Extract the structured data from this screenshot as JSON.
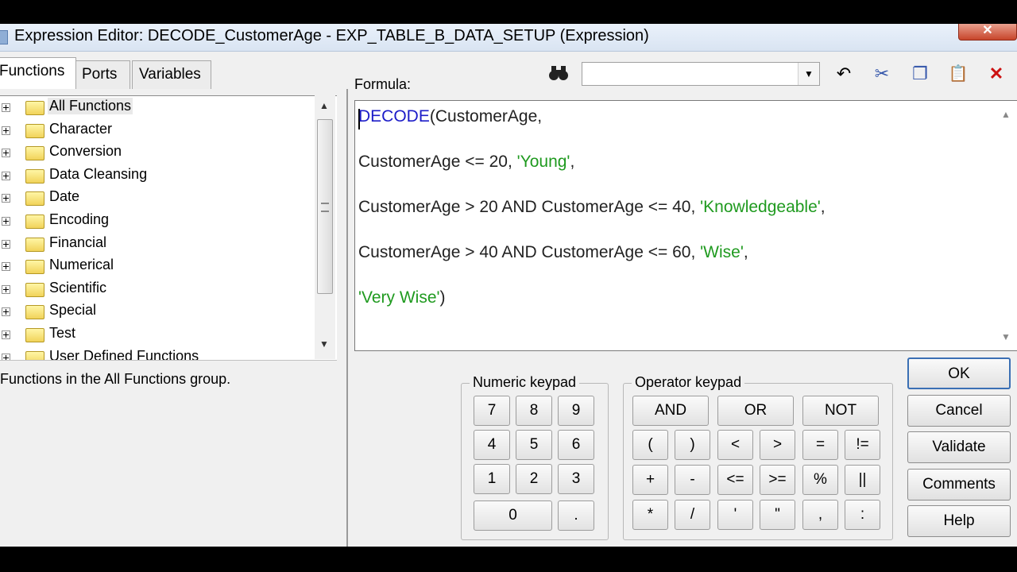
{
  "window": {
    "title": "Expression Editor: DECODE_CustomerAge - EXP_TABLE_B_DATA_SETUP (Expression)",
    "close_glyph": "✕"
  },
  "tabs": [
    {
      "label": "Functions"
    },
    {
      "label": "Ports"
    },
    {
      "label": "Variables"
    }
  ],
  "tree": {
    "items": [
      {
        "label": "All Functions"
      },
      {
        "label": "Character"
      },
      {
        "label": "Conversion"
      },
      {
        "label": "Data Cleansing"
      },
      {
        "label": "Date"
      },
      {
        "label": "Encoding"
      },
      {
        "label": "Financial"
      },
      {
        "label": "Numerical"
      },
      {
        "label": "Scientific"
      },
      {
        "label": "Special"
      },
      {
        "label": "Test"
      },
      {
        "label": "User Defined Functions"
      }
    ],
    "description": "Functions in the All Functions group."
  },
  "formula": {
    "label": "Formula:",
    "search_value": "",
    "lines": [
      {
        "parts": [
          {
            "t": "DECODE",
            "c": "kw"
          },
          {
            "t": "(CustomerAge,",
            "c": ""
          }
        ]
      },
      {
        "parts": [
          {
            "t": "CustomerAge <= 20, ",
            "c": ""
          },
          {
            "t": "'Young'",
            "c": "str"
          },
          {
            "t": ",",
            "c": ""
          }
        ]
      },
      {
        "parts": [
          {
            "t": "CustomerAge > 20 AND CustomerAge <= 40, ",
            "c": ""
          },
          {
            "t": "'Knowledgeable'",
            "c": "str"
          },
          {
            "t": ",",
            "c": ""
          }
        ]
      },
      {
        "parts": [
          {
            "t": "CustomerAge > 40 AND CustomerAge <= 60, ",
            "c": ""
          },
          {
            "t": "'Wise'",
            "c": "str"
          },
          {
            "t": ",",
            "c": ""
          }
        ]
      },
      {
        "parts": [
          {
            "t": "'Very Wise'",
            "c": "str"
          },
          {
            "t": ")",
            "c": ""
          }
        ]
      }
    ]
  },
  "toolbar": {
    "find_glyph": "⌕",
    "undo_glyph": "↶",
    "cut_glyph": "✂",
    "copy_glyph": "❐",
    "paste_glyph": "📋",
    "delete_glyph": "✕"
  },
  "numeric_keypad": {
    "title": "Numeric keypad",
    "keys": [
      "7",
      "8",
      "9",
      "4",
      "5",
      "6",
      "1",
      "2",
      "3",
      "0",
      "."
    ]
  },
  "operator_keypad": {
    "title": "Operator keypad",
    "logic_keys": [
      "AND",
      "OR",
      "NOT"
    ],
    "keys": [
      "(",
      ")",
      "<",
      ">",
      "=",
      "!=",
      "+",
      "-",
      "<=",
      ">=",
      "%",
      "||",
      "*",
      "/",
      "'",
      "\"",
      ",",
      ":"
    ]
  },
  "buttons": {
    "ok": "OK",
    "cancel": "Cancel",
    "validate": "Validate",
    "comments": "Comments",
    "help": "Help"
  }
}
